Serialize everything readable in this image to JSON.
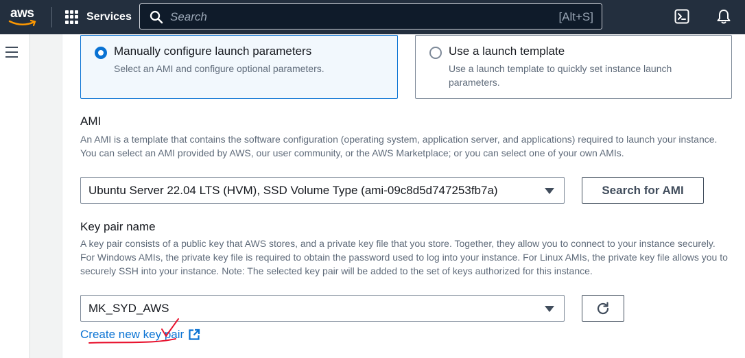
{
  "topnav": {
    "logo_text": "aws",
    "services_label": "Services",
    "search_placeholder": "Search",
    "search_shortcut": "[Alt+S]"
  },
  "launch_options": [
    {
      "title": "Manually configure launch parameters",
      "description": "Select an AMI and configure optional parameters.",
      "selected": true
    },
    {
      "title": "Use a launch template",
      "description": "Use a launch template to quickly set instance launch parameters.",
      "selected": false
    }
  ],
  "ami": {
    "label": "AMI",
    "description": "An AMI is a template that contains the software configuration (operating system, application server, and applications) required to launch your instance. You can select an AMI provided by AWS, our user community, or the AWS Marketplace; or you can select one of your own AMIs.",
    "selected_value": "Ubuntu Server 22.04 LTS (HVM), SSD Volume Type (ami-09c8d5d747253fb7a)",
    "search_button": "Search for AMI"
  },
  "key_pair": {
    "label": "Key pair name",
    "description": "A key pair consists of a public key that AWS stores, and a private key file that you store. Together, they allow you to connect to your instance securely. For Windows AMIs, the private key file is required to obtain the password used to log into your instance. For Linux AMIs, the private key file allows you to securely SSH into your instance. Note: The selected key pair will be added to the set of keys authorized for this instance.",
    "selected_value": "MK_SYD_AWS",
    "create_link": "Create new key pair"
  },
  "colors": {
    "nav_bg": "#232f3e",
    "accent_blue": "#0972d3",
    "smile_orange": "#ff9900",
    "annotation_red": "#e8112d"
  }
}
